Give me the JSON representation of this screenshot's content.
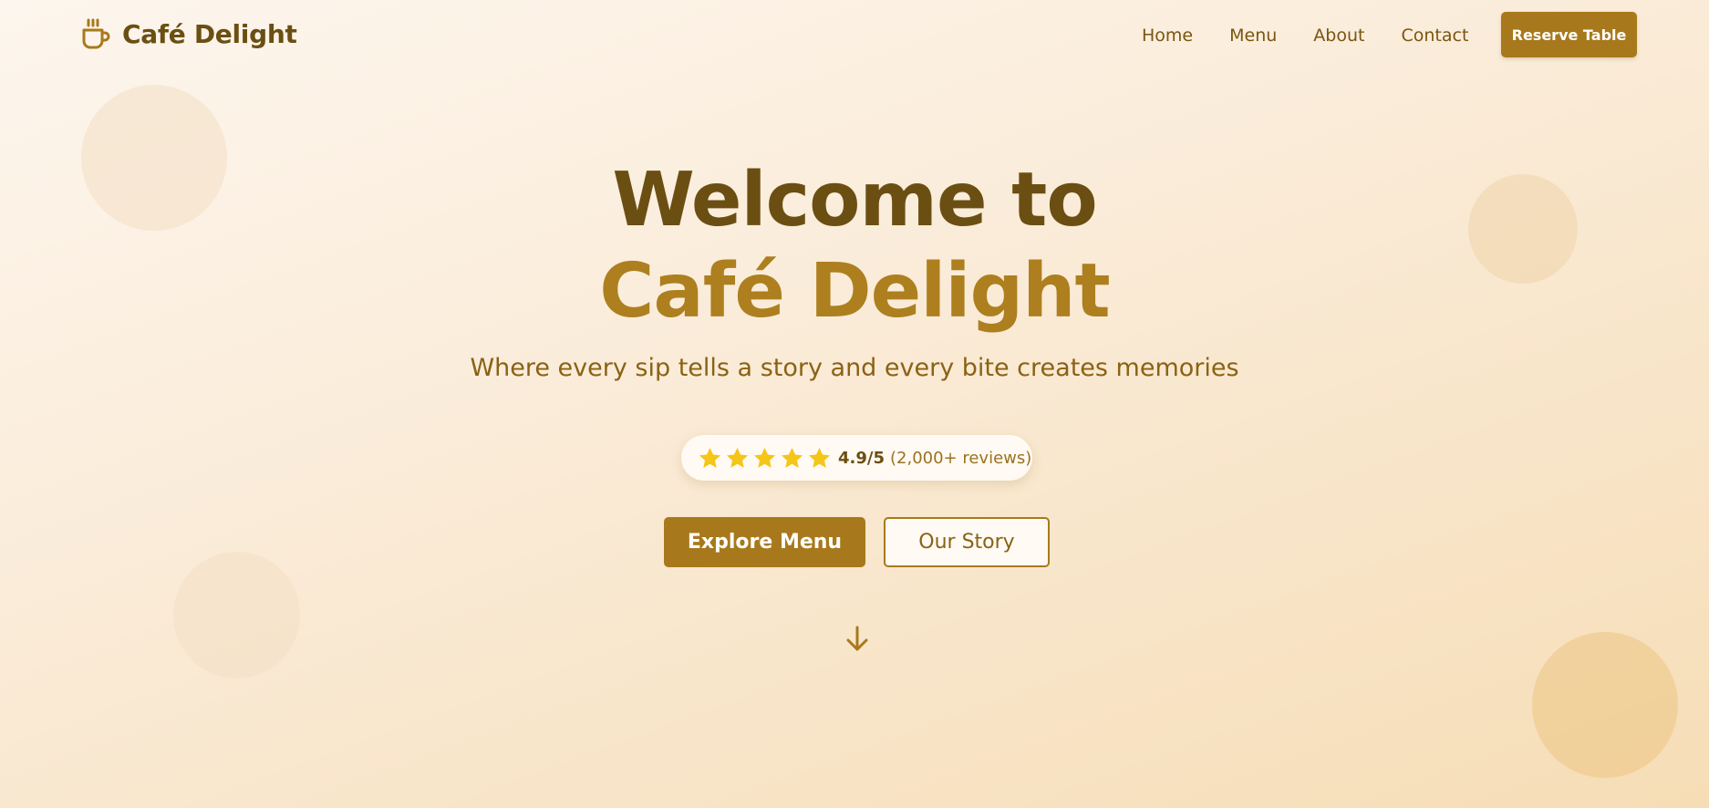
{
  "brand": {
    "name": "Café Delight",
    "icon": "coffee-cup-icon"
  },
  "nav": {
    "links": [
      "Home",
      "Menu",
      "About",
      "Contact"
    ],
    "cta": "Reserve Table"
  },
  "hero": {
    "title_line1": "Welcome to",
    "title_line2": "Café Delight",
    "tagline": "Where every sip tells a story and every bite creates memories"
  },
  "rating": {
    "stars": 5,
    "score": "4.9/5",
    "reviews": "(2,000+ reviews)"
  },
  "buttons": {
    "primary": "Explore Menu",
    "secondary": "Our Story"
  },
  "scroll_icon": "arrow-down-icon",
  "colors": {
    "brand_dark": "#6b4f12",
    "accent": "#a8791c",
    "star": "#f5c518"
  }
}
